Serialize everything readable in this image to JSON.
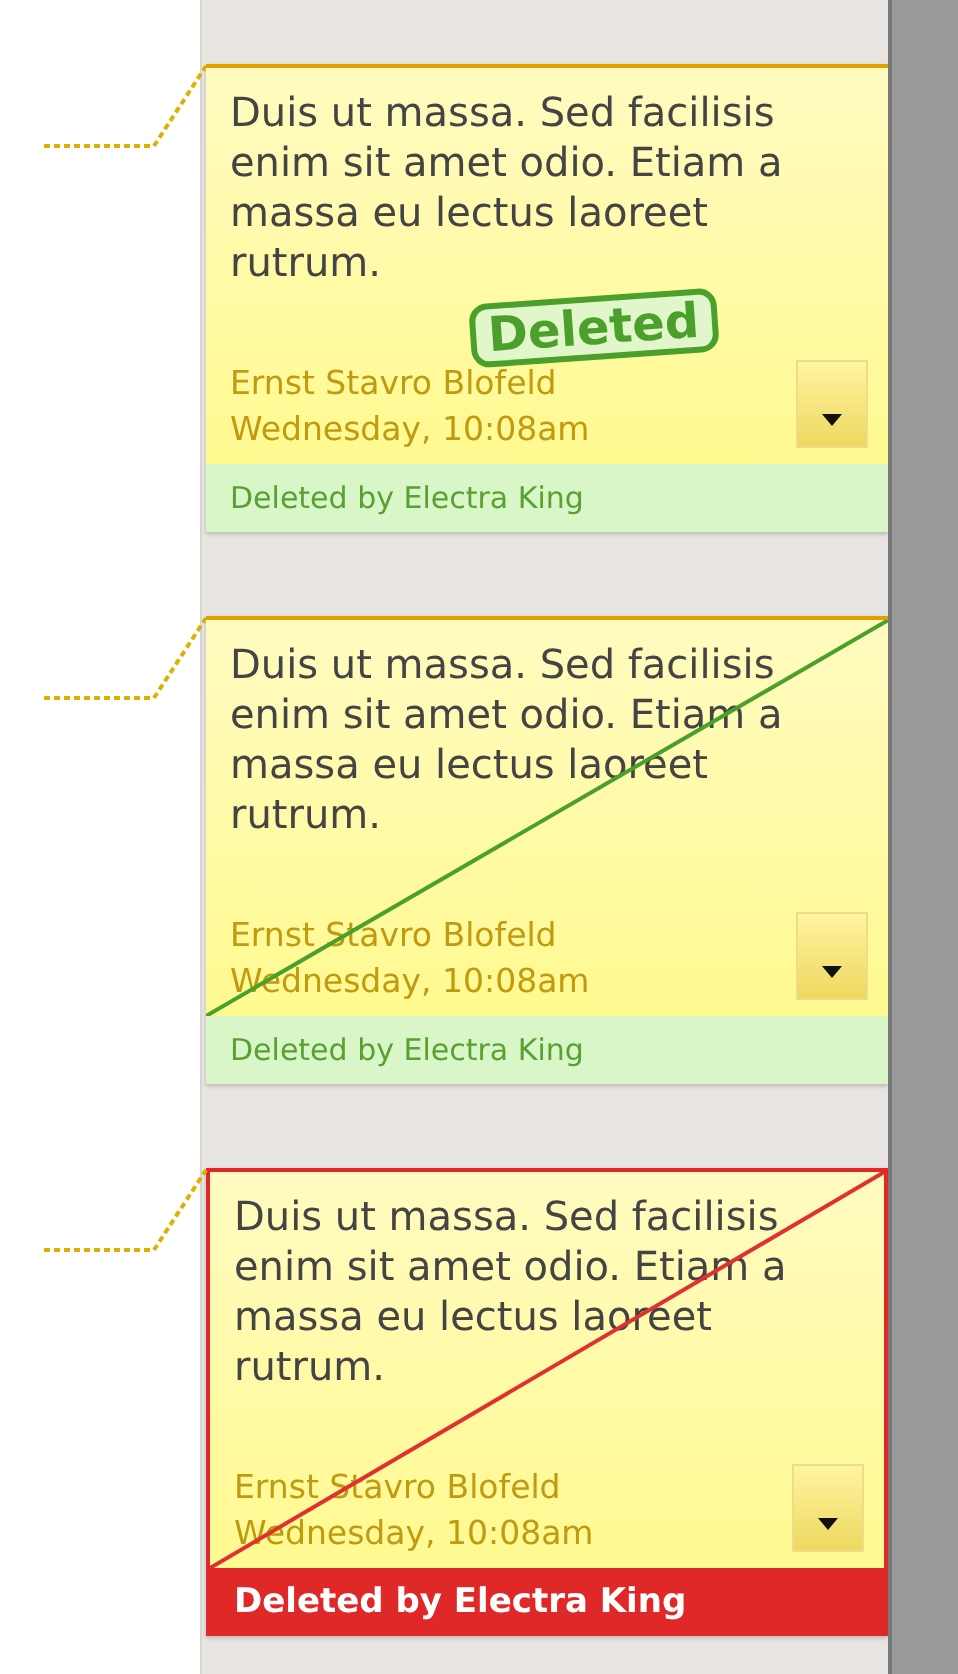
{
  "comments": [
    {
      "kind": "stamp",
      "stamp": "Deleted",
      "alert": false,
      "text": "Duis ut massa. Sed facilisis enim sit amet odio. Etiam a massa eu lectus laoreet rutrum.",
      "author": "Ernst Stavro Blofeld",
      "time": "Wednesday, 10:08am",
      "footer": "Deleted by Electra King"
    },
    {
      "kind": "strike",
      "alert": false,
      "text": "Duis ut massa. Sed facilisis enim sit amet odio. Etiam a massa eu lectus laoreet rutrum.",
      "author": "Ernst Stavro Blofeld",
      "time": "Wednesday, 10:08am",
      "footer": "Deleted by Electra King"
    },
    {
      "kind": "strike",
      "alert": true,
      "text": "Duis ut massa. Sed facilisis enim sit amet odio. Etiam a massa eu lectus laoreet rutrum.",
      "author": "Ernst Stavro Blofeld",
      "time": "Wednesday, 10:08am",
      "footer": "Deleted by Electra King"
    }
  ]
}
